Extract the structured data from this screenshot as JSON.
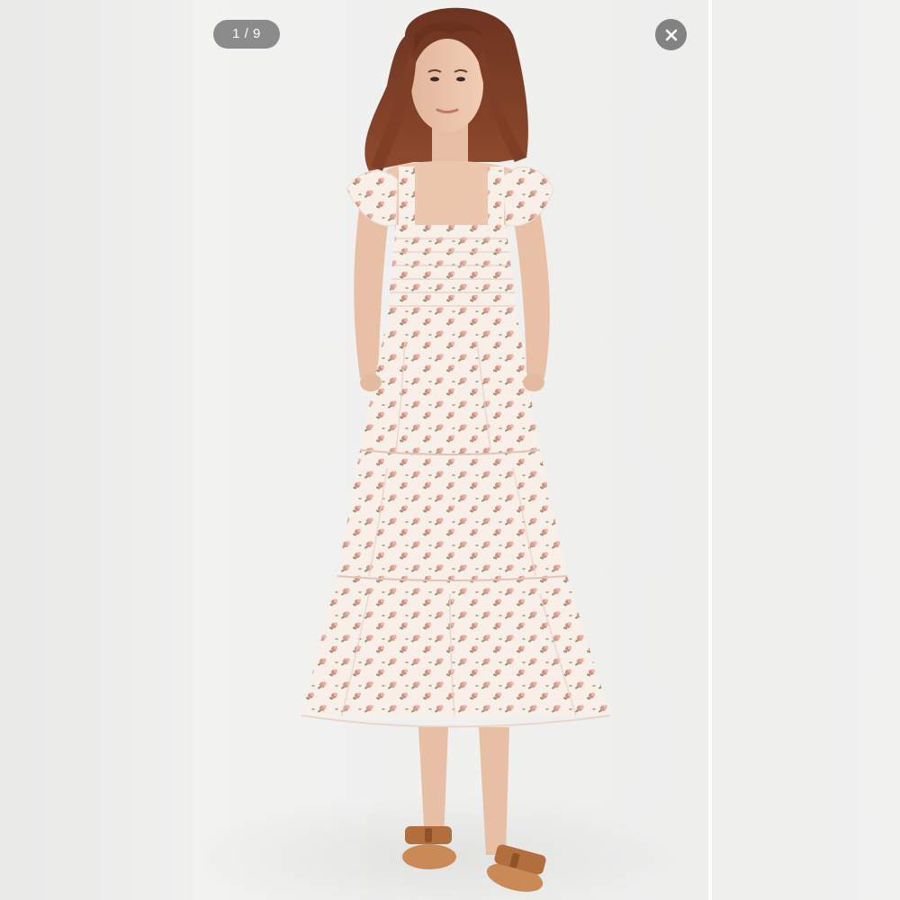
{
  "viewer": {
    "counter": "1 / 9"
  },
  "icons": {
    "close": "close-icon"
  },
  "colors": {
    "pill_bg": "#6e6e6e",
    "dress_base": "#f6ede6",
    "floral_pink": "#d9998c",
    "floral_green": "#8b9a6e",
    "hair": "#7a3f28",
    "sandal": "#b9743f"
  }
}
